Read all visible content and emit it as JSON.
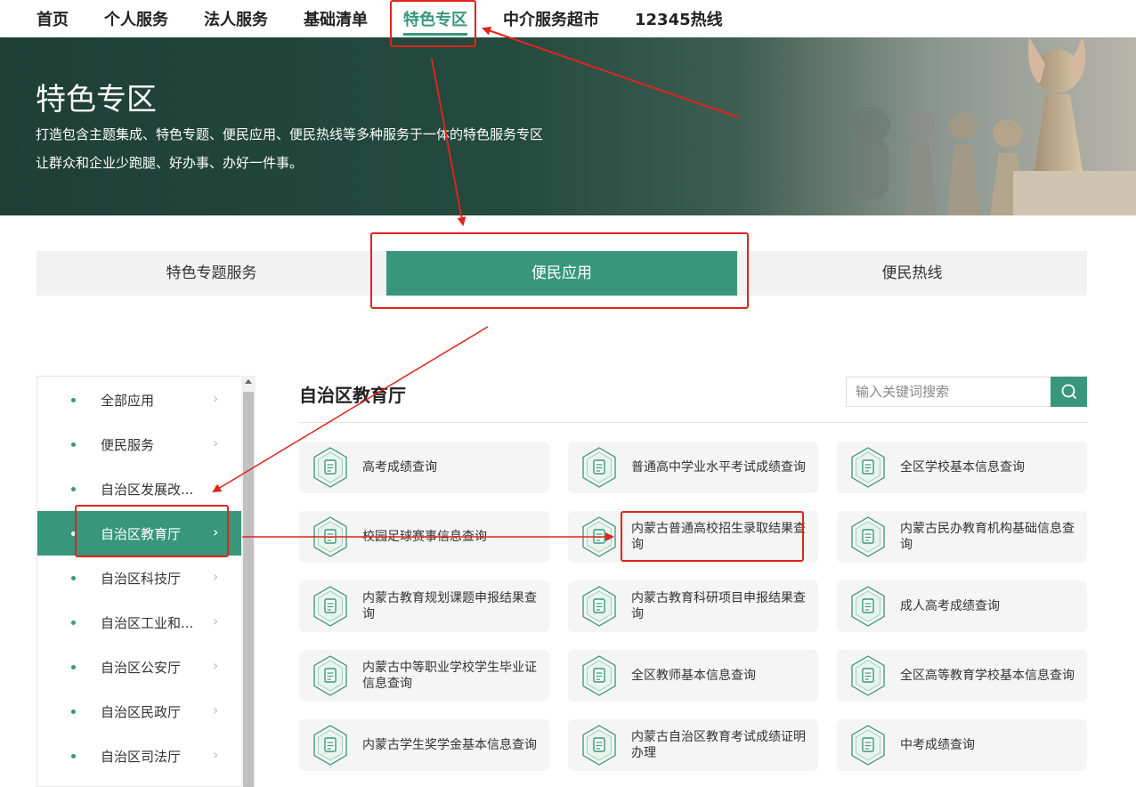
{
  "nav": {
    "items": [
      "首页",
      "个人服务",
      "法人服务",
      "基础清单",
      "特色专区",
      "中介服务超市",
      "12345热线"
    ],
    "active": "特色专区"
  },
  "banner": {
    "title": "特色专区",
    "desc1": "打造包含主题集成、特色专题、便民应用、便民热线等多种服务于一体的特色服务专区",
    "desc2": "让群众和企业少跑腿、好办事、办好一件事。"
  },
  "tabs": [
    "特色专题服务",
    "便民应用",
    "便民热线"
  ],
  "active_tab": "便民应用",
  "sidebar": {
    "items": [
      "全部应用",
      "便民服务",
      "自治区发展改...",
      "自治区教育厅",
      "自治区科技厅",
      "自治区工业和...",
      "自治区公安厅",
      "自治区民政厅",
      "自治区司法厅"
    ],
    "active": "自治区教育厅"
  },
  "main": {
    "title": "自治区教育厅",
    "search_placeholder": "输入关键词搜索",
    "cards": [
      {
        "label": "高考成绩查询",
        "icon": "exam-score-icon"
      },
      {
        "label": "普通高中学业水平考试成绩查询",
        "icon": "document-edit-icon"
      },
      {
        "label": "全区学校基本信息查询",
        "icon": "school-building-icon"
      },
      {
        "label": "校园足球赛事信息查询",
        "icon": "trophy-icon"
      },
      {
        "label": "内蒙古普通高校招生录取结果查询",
        "icon": "admission-search-icon"
      },
      {
        "label": "内蒙古民办教育机构基础信息查询",
        "icon": "institution-icon"
      },
      {
        "label": "内蒙古教育规划课题申报结果查询",
        "icon": "report-icon"
      },
      {
        "label": "内蒙古教育科研项目申报结果查询",
        "icon": "research-icon"
      },
      {
        "label": "成人高考成绩查询",
        "icon": "adult-exam-icon"
      },
      {
        "label": "内蒙古中等职业学校学生毕业证信息查询",
        "icon": "diploma-icon"
      },
      {
        "label": "全区教师基本信息查询",
        "icon": "teacher-icon"
      },
      {
        "label": "全区高等教育学校基本信息查询",
        "icon": "university-icon"
      },
      {
        "label": "内蒙古学生奖学金基本信息查询",
        "icon": "scholarship-icon"
      },
      {
        "label": "内蒙古自治区教育考试成绩证明办理",
        "icon": "certificate-icon"
      },
      {
        "label": "中考成绩查询",
        "icon": "graduation-cap-icon"
      }
    ]
  },
  "colors": {
    "accent": "#38977a",
    "annotation": "#e0241c",
    "banner": "#1f3f35"
  }
}
